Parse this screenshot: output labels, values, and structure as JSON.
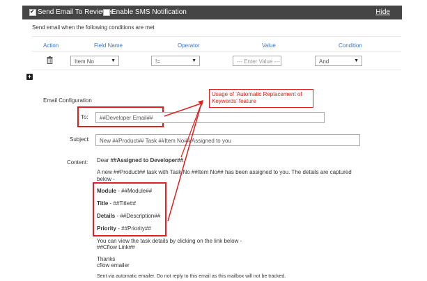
{
  "header": {
    "send_email_label": "Send Email To Reviewer",
    "send_email_checked": true,
    "sms_label": "Enable SMS Notification",
    "sms_checked": false,
    "hide_label": "Hide"
  },
  "conditions_text": "Send email when the following conditions are met",
  "table": {
    "columns": [
      "Action",
      "Field Name",
      "Operator",
      "Value",
      "Condition"
    ],
    "row": {
      "field": "Item No",
      "operator": "!=",
      "value_placeholder": "--- Enter Value ---",
      "condition": "And"
    }
  },
  "add_icon": "plus-icon",
  "email_config": {
    "title": "Email Configuration",
    "to_label": "To:",
    "to_value": "##Developer Email##",
    "subject_label": "Subject:",
    "subject_value": "New ##Product## Task ##Item No## Assigned to you",
    "content_label": "Content:",
    "content": {
      "greeting_prefix": "Dear ",
      "greeting_bold": "##Assigned to Developer##",
      "greeting_suffix": ",",
      "intro_line1": "A new ##Product## task with Task No ##Item No## has been assigned to you. The details are captured",
      "intro_line2": "below -",
      "fields": [
        {
          "label": "Module",
          "value": " - ##Module##"
        },
        {
          "label": "Title",
          "value": " - ##Title##"
        },
        {
          "label": "Details",
          "value": " - ##Description##"
        },
        {
          "label": "Priority",
          "value": " - ##Priority##"
        }
      ],
      "view_line1": "You can view the task details by clicking on the link below -",
      "view_line2": "##Cflow Link##",
      "thanks": "Thanks",
      "signature": "cflow emailer",
      "footer": "Sent via automatic emailer. Do not reply to this email as this mailbox will not be tracked."
    }
  },
  "annotation": {
    "callout_text": "Usage of 'Automatic Replacement of Keywords' feature"
  },
  "colors": {
    "header_bg": "#454545",
    "accent_blue": "#3d73c7",
    "annotation_red": "#e0201e"
  }
}
